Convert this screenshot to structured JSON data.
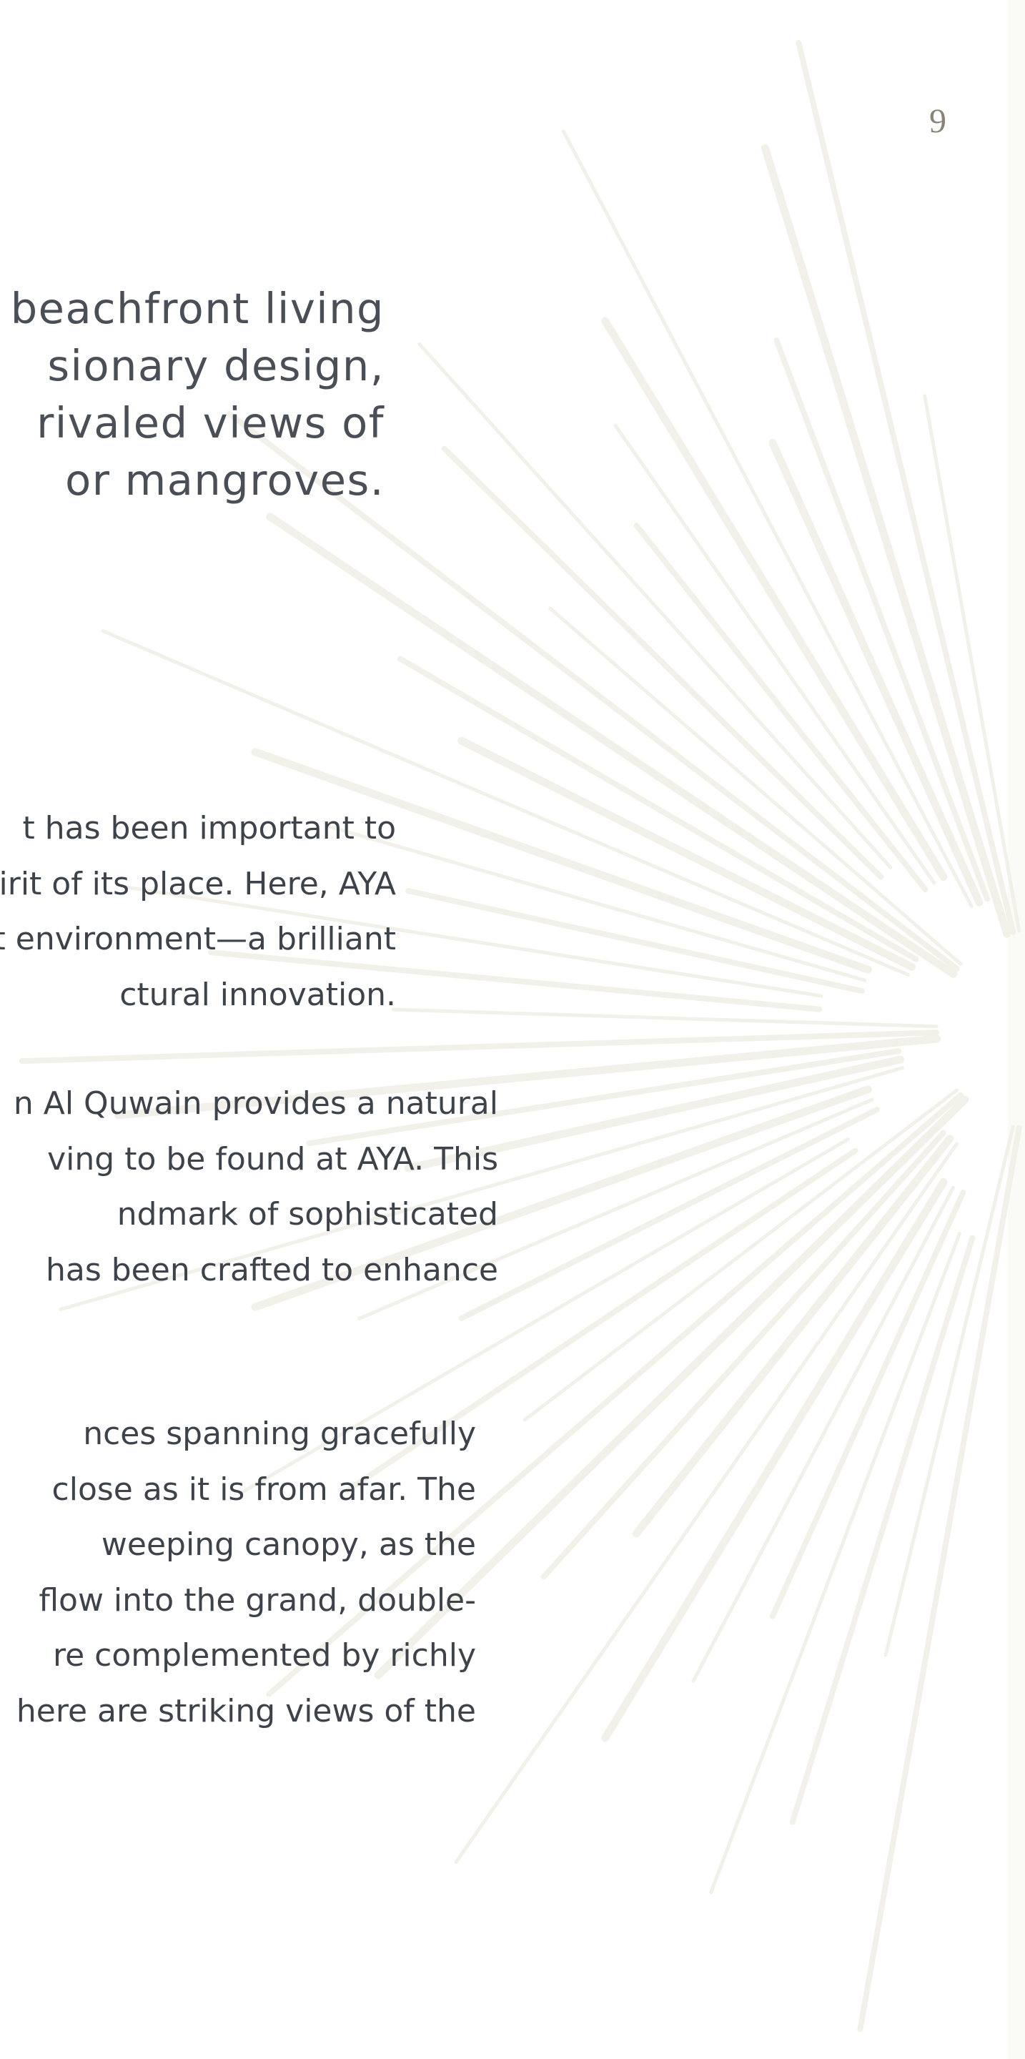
{
  "page": {
    "number": "9",
    "colors": {
      "background": "#ffffff",
      "text": "#3e434b",
      "page_number": "#8a8476",
      "sunburst_rays": "#f1f1ea"
    }
  },
  "lead": {
    "lines": [
      "r beachfront living",
      "sionary design,",
      "rivaled views of",
      "or mangroves."
    ]
  },
  "paragraphs": [
    {
      "lines": [
        "t has been important to",
        "spirit of its place. Here, AYA",
        "nt environment—a brilliant",
        "ctural innovation."
      ]
    },
    {
      "lines": [
        "n Al Quwain provides a natural",
        "ving to be found at AYA. This",
        "ndmark of sophisticated",
        "has been crafted to enhance"
      ]
    },
    {
      "lines": [
        "nces spanning gracefully",
        "close as it is from afar. The",
        "weeping canopy, as the",
        "flow into the grand, double-",
        "re complemented by richly",
        "here are striking views of the"
      ]
    }
  ]
}
